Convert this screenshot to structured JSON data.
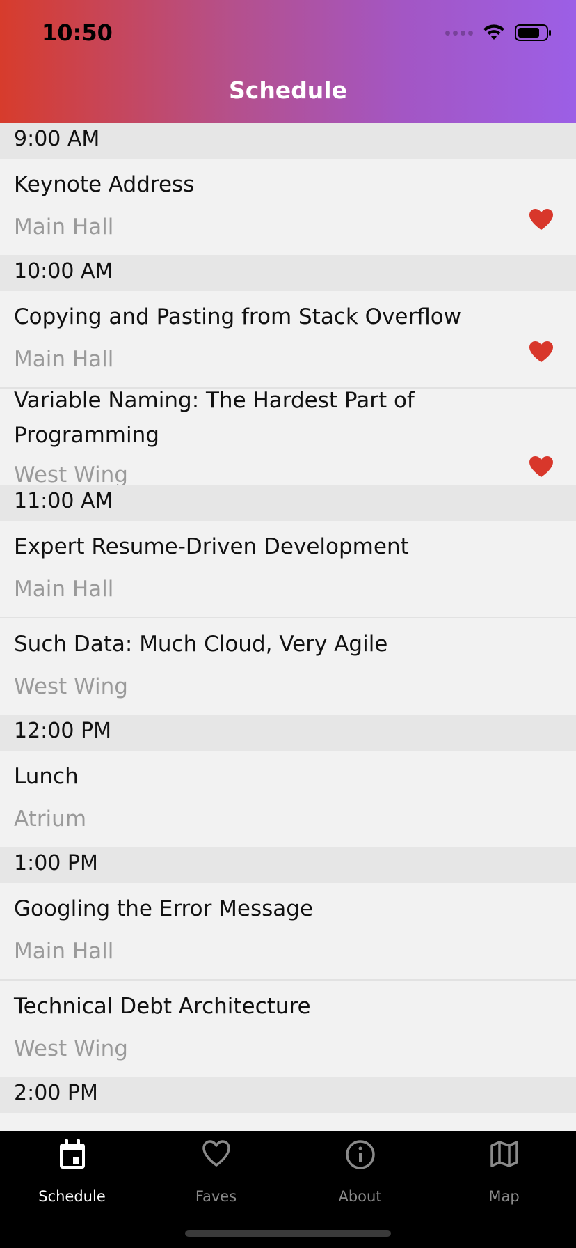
{
  "status_bar": {
    "time": "10:50"
  },
  "header": {
    "title": "Schedule"
  },
  "sections": [
    {
      "time": "9:00 AM",
      "sessions": [
        {
          "title": "Keynote Address",
          "location": "Main Hall",
          "favorite": true
        }
      ]
    },
    {
      "time": "10:00 AM",
      "sessions": [
        {
          "title": "Copying and Pasting from Stack Overflow",
          "location": "Main Hall",
          "favorite": true
        },
        {
          "title": "Variable Naming: The Hardest Part of Programming",
          "location": "West Wing",
          "favorite": true
        }
      ]
    },
    {
      "time": "11:00 AM",
      "sessions": [
        {
          "title": "Expert Resume-Driven Development",
          "location": "Main Hall",
          "favorite": false
        },
        {
          "title": "Such Data: Much Cloud, Very Agile",
          "location": "West Wing",
          "favorite": false
        }
      ]
    },
    {
      "time": "12:00 PM",
      "sessions": [
        {
          "title": "Lunch",
          "location": "Atrium",
          "favorite": false
        }
      ]
    },
    {
      "time": "1:00 PM",
      "sessions": [
        {
          "title": "Googling the Error Message",
          "location": "Main Hall",
          "favorite": false
        },
        {
          "title": "Technical Debt Architecture",
          "location": "West Wing",
          "favorite": false
        }
      ]
    },
    {
      "time": "2:00 PM",
      "sessions": []
    }
  ],
  "tabs": [
    {
      "label": "Schedule",
      "icon": "calendar-icon",
      "active": true
    },
    {
      "label": "Faves",
      "icon": "heart-outline-icon",
      "active": false
    },
    {
      "label": "About",
      "icon": "info-icon",
      "active": false
    },
    {
      "label": "Map",
      "icon": "map-icon",
      "active": false
    }
  ],
  "colors": {
    "header_gradient_start": "#d73c2c",
    "header_gradient_end": "#9c5fe6",
    "favorite_heart": "#d8372b",
    "section_header_bg": "#e6e6e6",
    "row_bg": "#f2f2f2",
    "location_text": "#9a9a9a",
    "tabbar_bg": "#000000"
  }
}
